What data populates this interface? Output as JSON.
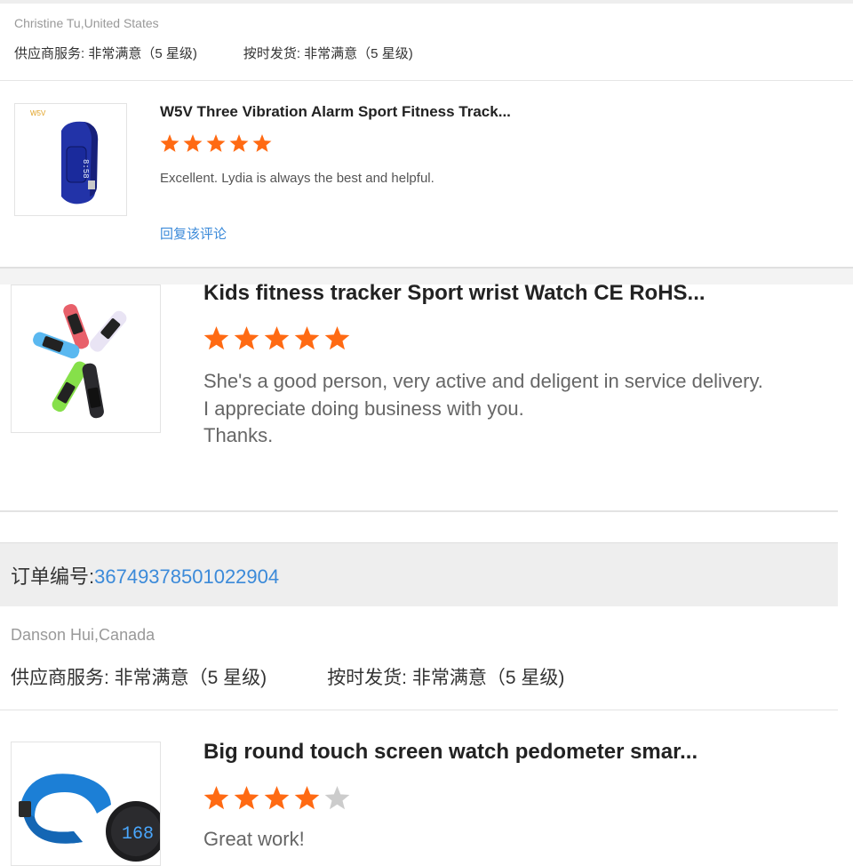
{
  "review1": {
    "reviewer": "Christine Tu,United States",
    "supplier_service": "供应商服务: 非常满意（5 星级)",
    "on_time_shipment": "按时发货: 非常满意（5 星级)",
    "product_title": "W5V Three Vibration Alarm Sport Fitness Track...",
    "thumb_brand": "W5V",
    "rating": 5,
    "comment": "Excellent. Lydia is always the best and helpful.",
    "reply_link": "回复该评论"
  },
  "review2": {
    "product_title": "Kids fitness tracker Sport wrist Watch CE RoHS...",
    "rating": 5,
    "comment_lines": [
      "She's a good person, very active and deligent in service delivery.",
      "I appreciate doing business with you.",
      "Thanks."
    ]
  },
  "order": {
    "label": "订单编号:",
    "number": "36749378501022904"
  },
  "review3": {
    "reviewer": "Danson Hui,Canada",
    "supplier_service": "供应商服务: 非常满意（5 星级)",
    "on_time_shipment": "按时发货: 非常满意（5 星级)",
    "product_title": "Big round touch screen watch pedometer smar...",
    "rating": 4,
    "max_rating": 5,
    "comment": "Great work!"
  },
  "colors": {
    "star_on": "#ff6a13",
    "star_off": "#cccccc",
    "link": "#3b8ad9"
  }
}
